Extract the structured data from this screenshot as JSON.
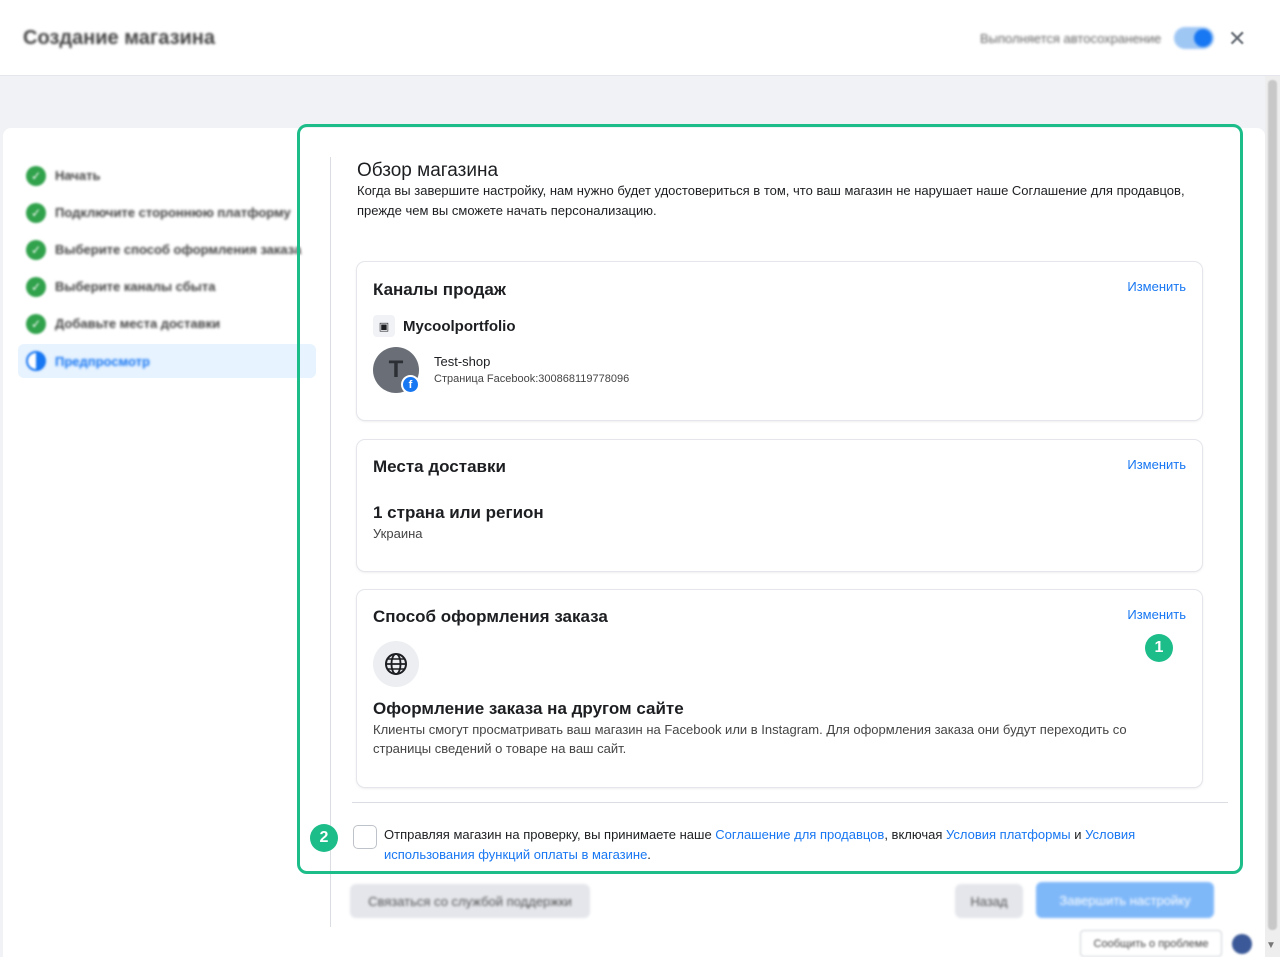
{
  "header": {
    "title": "Создание магазина",
    "autosave_label": "Выполняется автосохранение",
    "close_icon": "close-icon"
  },
  "steps": [
    {
      "label": "Начать",
      "status": "done"
    },
    {
      "label": "Подключите стороннюю платформу",
      "status": "done"
    },
    {
      "label": "Выберите способ оформления заказа",
      "status": "done"
    },
    {
      "label": "Выберите каналы сбыта",
      "status": "done"
    },
    {
      "label": "Добавьте места доставки",
      "status": "done"
    },
    {
      "label": "Предпросмотр",
      "status": "active"
    }
  ],
  "overview": {
    "title": "Обзор магазина",
    "description": "Когда вы завершите настройку, нам нужно будет удостовериться в том, что ваш магазин не нарушает наше Соглашение для продавцов, прежде чем вы сможете начать персонализацию."
  },
  "sales_channels": {
    "title": "Каналы продаж",
    "edit_label": "Изменить",
    "shop_name": "Mycoolportfolio",
    "page": {
      "avatar_letter": "T",
      "name": "Test-shop",
      "subtitle": "Страница Facebook:300868119778096"
    }
  },
  "shipping": {
    "title": "Места доставки",
    "edit_label": "Изменить",
    "region_count": "1 страна или регион",
    "region": "Украина"
  },
  "checkout": {
    "title": "Способ оформления заказа",
    "edit_label": "Изменить",
    "method_title": "Оформление заказа на другом сайте",
    "method_desc": "Клиенты смогут просматривать ваш магазин на Facebook или в Instagram. Для оформления заказа они будут переходить со страницы сведений о товаре на ваш сайт."
  },
  "terms": {
    "text_1": "Отправляя магазин на проверку, вы принимаете наше ",
    "link_1": "Соглашение для продавцов",
    "text_2": ", включая ",
    "link_2": "Условия платформы",
    "text_3": " и ",
    "link_3": "Условия использования функций оплаты в магазине",
    "text_4": "."
  },
  "footer": {
    "support_label": "Связаться со службой поддержки",
    "back_label": "Назад",
    "finish_label": "Завершить настройку",
    "report_label": "Сообщить о проблеме"
  },
  "annotations": {
    "marker_1": "1",
    "marker_2": "2",
    "accent_color": "#1dbd8a"
  },
  "colors": {
    "brand": "#1877f2",
    "success": "#31a24c"
  }
}
